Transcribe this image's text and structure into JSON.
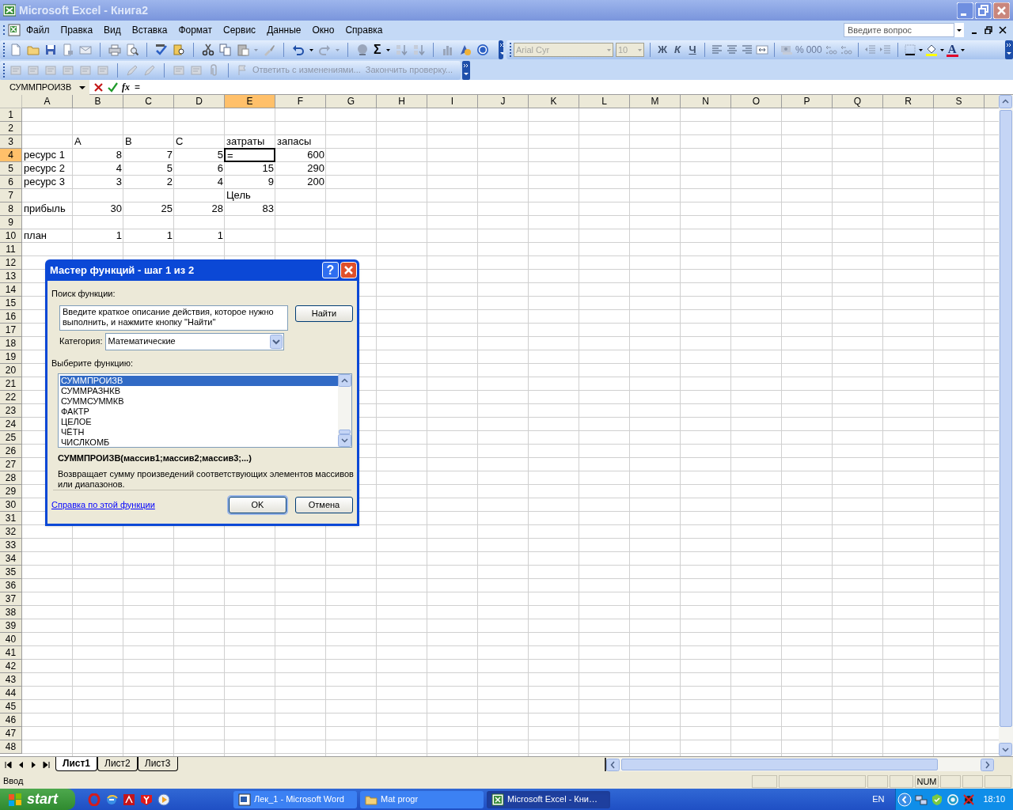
{
  "window": {
    "title": "Microsoft Excel - Книга2"
  },
  "menu": [
    "Файл",
    "Правка",
    "Вид",
    "Вставка",
    "Формат",
    "Сервис",
    "Данные",
    "Окно",
    "Справка"
  ],
  "help_box": {
    "placeholder": "Введите вопрос"
  },
  "standard_toolbar": {
    "sum_glyph": "Σ"
  },
  "formatting_toolbar": {
    "font": "Arial Cyr",
    "size": "10",
    "style_buttons": [
      "Ж",
      "К",
      "Ч"
    ],
    "number_buttons": [
      "%",
      "000"
    ],
    "font_color_glyph": "A"
  },
  "reviewing_toolbar": {
    "buttons": [
      {
        "label": "Ответить с изменениями...",
        "disabled": true
      },
      {
        "label": "Закончить проверку...",
        "disabled": true
      }
    ]
  },
  "formula_bar": {
    "name_box": "СУММПРОИЗВ",
    "function_glyph": "fx",
    "formula": "="
  },
  "sheet": {
    "columns": [
      {
        "label": "A",
        "selected": false
      },
      {
        "label": "B",
        "selected": false
      },
      {
        "label": "C",
        "selected": false
      },
      {
        "label": "D",
        "selected": false
      },
      {
        "label": "E",
        "selected": true
      },
      {
        "label": "F",
        "selected": false
      },
      {
        "label": "G",
        "selected": false
      },
      {
        "label": "H",
        "selected": false
      },
      {
        "label": "I",
        "selected": false
      },
      {
        "label": "J",
        "selected": false
      },
      {
        "label": "K",
        "selected": false
      },
      {
        "label": "L",
        "selected": false
      },
      {
        "label": "M",
        "selected": false
      },
      {
        "label": "N",
        "selected": false
      },
      {
        "label": "O",
        "selected": false
      },
      {
        "label": "P",
        "selected": false
      },
      {
        "label": "Q",
        "selected": false
      },
      {
        "label": "R",
        "selected": false
      },
      {
        "label": "S",
        "selected": false
      }
    ],
    "rows": [
      {
        "number": "1",
        "selected": false
      },
      {
        "number": "2",
        "selected": false
      },
      {
        "number": "3",
        "selected": false,
        "cells": {
          "B": {
            "text": "A"
          },
          "C": {
            "text": "B"
          },
          "D": {
            "text": "C"
          },
          "E": {
            "text": "затраты"
          },
          "F": {
            "text": "запасы"
          }
        }
      },
      {
        "number": "4",
        "selected": true,
        "cells": {
          "A": {
            "text": "ресурс 1"
          },
          "B": {
            "text": "8",
            "kind": "number"
          },
          "C": {
            "text": "7",
            "kind": "number"
          },
          "D": {
            "text": "5",
            "kind": "number"
          },
          "E": {
            "text": "=",
            "active": true
          },
          "F": {
            "text": "600",
            "kind": "number"
          }
        }
      },
      {
        "number": "5",
        "selected": false,
        "cells": {
          "A": {
            "text": "ресурс 2"
          },
          "B": {
            "text": "4",
            "kind": "number"
          },
          "C": {
            "text": "5",
            "kind": "number"
          },
          "D": {
            "text": "6",
            "kind": "number"
          },
          "E": {
            "text": "15",
            "kind": "number"
          },
          "F": {
            "text": "290",
            "kind": "number"
          }
        }
      },
      {
        "number": "6",
        "selected": false,
        "cells": {
          "A": {
            "text": "ресурс 3"
          },
          "B": {
            "text": "3",
            "kind": "number"
          },
          "C": {
            "text": "2",
            "kind": "number"
          },
          "D": {
            "text": "4",
            "kind": "number"
          },
          "E": {
            "text": "9",
            "kind": "number"
          },
          "F": {
            "text": "200",
            "kind": "number"
          }
        }
      },
      {
        "number": "7",
        "selected": false,
        "cells": {
          "E": {
            "text": "Цель"
          }
        }
      },
      {
        "number": "8",
        "selected": false,
        "cells": {
          "A": {
            "text": "прибыль"
          },
          "B": {
            "text": "30",
            "kind": "number"
          },
          "C": {
            "text": "25",
            "kind": "number"
          },
          "D": {
            "text": "28",
            "kind": "number"
          },
          "E": {
            "text": "83",
            "kind": "number"
          }
        }
      },
      {
        "number": "9",
        "selected": false
      },
      {
        "number": "10",
        "selected": false,
        "cells": {
          "A": {
            "text": "план"
          },
          "B": {
            "text": "1",
            "kind": "number"
          },
          "C": {
            "text": "1",
            "kind": "number"
          },
          "D": {
            "text": "1",
            "kind": "number"
          }
        }
      },
      {
        "number": "11",
        "selected": false
      },
      {
        "number": "12",
        "selected": false
      },
      {
        "number": "13",
        "selected": false
      },
      {
        "number": "14",
        "selected": false
      },
      {
        "number": "15",
        "selected": false
      },
      {
        "number": "16",
        "selected": false
      },
      {
        "number": "17",
        "selected": false
      },
      {
        "number": "18",
        "selected": false
      },
      {
        "number": "19",
        "selected": false
      },
      {
        "number": "20",
        "selected": false
      },
      {
        "number": "21",
        "selected": false
      },
      {
        "number": "22",
        "selected": false
      },
      {
        "number": "23",
        "selected": false
      },
      {
        "number": "24",
        "selected": false
      },
      {
        "number": "25",
        "selected": false
      },
      {
        "number": "26",
        "selected": false
      },
      {
        "number": "27",
        "selected": false
      },
      {
        "number": "28",
        "selected": false
      },
      {
        "number": "29",
        "selected": false
      },
      {
        "number": "30",
        "selected": false
      },
      {
        "number": "31",
        "selected": false
      },
      {
        "number": "32",
        "selected": false
      },
      {
        "number": "33",
        "selected": false
      },
      {
        "number": "34",
        "selected": false
      },
      {
        "number": "35",
        "selected": false
      },
      {
        "number": "36",
        "selected": false
      },
      {
        "number": "37",
        "selected": false
      },
      {
        "number": "38",
        "selected": false
      },
      {
        "number": "39",
        "selected": false
      },
      {
        "number": "40",
        "selected": false
      },
      {
        "number": "41",
        "selected": false
      },
      {
        "number": "42",
        "selected": false
      },
      {
        "number": "43",
        "selected": false
      },
      {
        "number": "44",
        "selected": false
      },
      {
        "number": "45",
        "selected": false
      },
      {
        "number": "46",
        "selected": false
      },
      {
        "number": "47",
        "selected": false
      },
      {
        "number": "48",
        "selected": false
      }
    ]
  },
  "sheet_tabs": [
    {
      "label": "Лист1",
      "selected": true
    },
    {
      "label": "Лист2",
      "selected": false
    },
    {
      "label": "Лист3",
      "selected": false
    }
  ],
  "status_bar": {
    "mode": "Ввод",
    "indicators": [
      "NUM"
    ]
  },
  "dialog": {
    "title": "Мастер функций - шаг 1 из 2",
    "help_glyph": "?",
    "search_label": "Поиск функции:",
    "search_text": "Введите краткое описание действия, которое нужно выполнить, и нажмите кнопку \"Найти\"",
    "find_button": "Найти",
    "category_label": "Категория:",
    "category": "Математические",
    "list_label": "Выберите функцию:",
    "functions": [
      {
        "label": "СУММПРОИЗВ",
        "selected": true
      },
      {
        "label": "СУММРАЗНКВ",
        "selected": false
      },
      {
        "label": "СУММСУММКВ",
        "selected": false
      },
      {
        "label": "ФАКТР",
        "selected": false
      },
      {
        "label": "ЦЕЛОЕ",
        "selected": false
      },
      {
        "label": "ЧЁТН",
        "selected": false
      },
      {
        "label": "ЧИСЛКОМБ",
        "selected": false
      }
    ],
    "signature": "СУММПРОИЗВ(массив1;массив2;массив3;...)",
    "description": "Возвращает сумму произведений соответствующих элементов массивов или диапазонов.",
    "help_link": "Справка по этой функции",
    "buttons": [
      {
        "label": "OK",
        "default": true
      },
      {
        "label": "Отмена",
        "default": false
      }
    ]
  },
  "taskbar": {
    "start": "start",
    "tasks": [
      {
        "label": "Лек_1 - Microsoft Word",
        "kind": "word",
        "selected": false
      },
      {
        "label": "Mat progr",
        "kind": "folder",
        "selected": false
      },
      {
        "label": "Microsoft Excel - Кни…",
        "kind": "excel",
        "selected": true
      }
    ],
    "language": "EN",
    "clock": "18:10"
  }
}
